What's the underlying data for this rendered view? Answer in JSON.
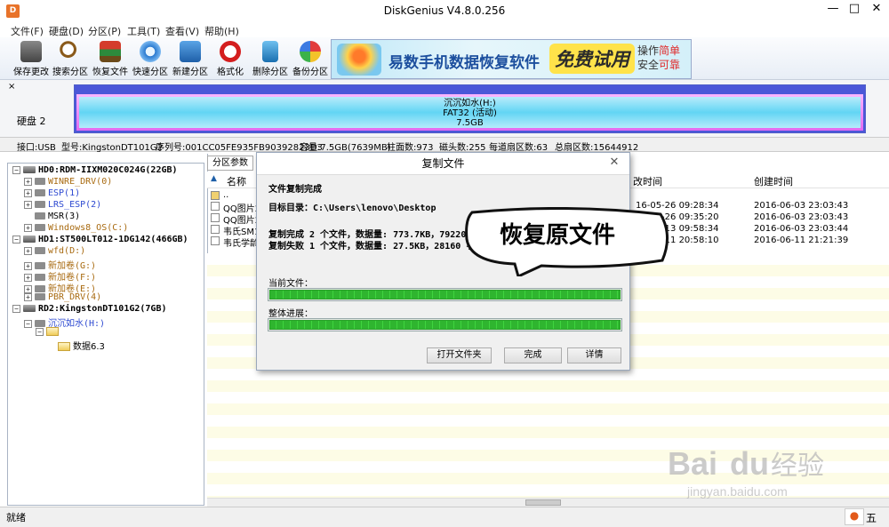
{
  "window": {
    "title": "DiskGenius V4.8.0.256",
    "icon_letter": "D",
    "min": "—",
    "max": "□",
    "close": "✕"
  },
  "menu": [
    "文件(F)",
    "硬盘(D)",
    "分区(P)",
    "工具(T)",
    "查看(V)",
    "帮助(H)"
  ],
  "toolbar": [
    "保存更改",
    "搜索分区",
    "恢复文件",
    "快速分区",
    "新建分区",
    "格式化",
    "删除分区",
    "备份分区"
  ],
  "ad": {
    "text": "易数手机数据恢复软件",
    "badge": "免费试用",
    "line1": "操作",
    "line1b": "简单",
    "line2": "安全",
    "line2b": "可靠"
  },
  "disk": {
    "label": "硬盘 2",
    "partition_name": "沉沉如水(H:)",
    "partition_fs": "FAT32 (活动)",
    "partition_size": "7.5GB",
    "collapse": "×"
  },
  "info": {
    "interface": "接口:USB",
    "model": "型号:KingstonDT101G2",
    "serial": "序列号:001CC05FE935FB90392823D3",
    "capacity": "容量:7.5GB(7639MB)",
    "cylinders": "柱面数:973",
    "heads": "磁头数:255",
    "sectors_per_track": "每道扇区数:63",
    "total_sectors": "总扇区数:15644912"
  },
  "tree": [
    {
      "label": "HD0:RDM-IIXM020C024G(22GB)",
      "level": 0,
      "kind": "disk",
      "toggle": "−"
    },
    {
      "label": "WINRE_DRV(0)",
      "level": 1,
      "kind": "part",
      "color": "brown",
      "toggle": "+"
    },
    {
      "label": "ESP(1)",
      "level": 1,
      "kind": "part",
      "color": "blue",
      "toggle": "+"
    },
    {
      "label": "LRS_ESP(2)",
      "level": 1,
      "kind": "part",
      "color": "blue",
      "toggle": "+"
    },
    {
      "label": "MSR(3)",
      "level": 1,
      "kind": "part",
      "color": "",
      "toggle": ""
    },
    {
      "label": "Windows8_OS(C:)",
      "level": 1,
      "kind": "part",
      "color": "brown",
      "toggle": "+"
    },
    {
      "label": "HD1:ST500LT012-1DG142(466GB)",
      "level": 0,
      "kind": "disk",
      "toggle": "−"
    },
    {
      "label": "wfd(D:)",
      "level": 1,
      "kind": "part",
      "color": "brown",
      "toggle": "+"
    },
    {
      "label": "新加卷(G:)",
      "level": 1,
      "kind": "part",
      "color": "brown",
      "toggle": "+"
    },
    {
      "label": "新加卷(F:)",
      "level": 1,
      "kind": "part",
      "color": "brown",
      "toggle": "+"
    },
    {
      "label": "新加卷(E:)",
      "level": 1,
      "kind": "part",
      "color": "brown",
      "toggle": "+"
    },
    {
      "label": "PBR_DRV(4)",
      "level": 1,
      "kind": "part",
      "color": "brown",
      "toggle": "+"
    },
    {
      "label": "RD2:KingstonDT101G2(7GB)",
      "level": 0,
      "kind": "disk",
      "toggle": "−"
    },
    {
      "label": "沉沉如水(H:)",
      "level": 1,
      "kind": "part",
      "color": "blue",
      "toggle": "−"
    },
    {
      "label": "",
      "level": 2,
      "kind": "folder",
      "color": "",
      "toggle": "−"
    },
    {
      "label": "数据6.3",
      "level": 3,
      "kind": "folder",
      "color": "",
      "toggle": ""
    }
  ],
  "right": {
    "tab": "分区参数",
    "col_name": "名称",
    "col_modified": "改时间",
    "col_created": "创建时间",
    "rows": [
      {
        "name": "..",
        "modified": "",
        "created": ""
      },
      {
        "name": "QQ图片20",
        "modified": "16-05-26 09:28:34",
        "created": "2016-06-03 23:03:43"
      },
      {
        "name": "QQ图片20",
        "modified": "16-05-26 09:35:20",
        "created": "2016-06-03 23:03:43"
      },
      {
        "name": "韦氏SM1.",
        "modified": "16-06-13 09:58:34",
        "created": "2016-06-03 23:03:44"
      },
      {
        "name": "韦氏学龄",
        "modified": "16-06-11 20:58:10",
        "created": "2016-06-11 21:21:39"
      }
    ]
  },
  "dialog": {
    "title": "复制文件",
    "close": "✕",
    "status": "文件复制完成",
    "target": "目标目录：C:\\Users\\lenovo\\Desktop",
    "ok_line": "复制完成 2 个文件，数据量: 773.7KB，792202 字节。",
    "fail_line": "复制失败 1 个文件，数据量: 27.5KB，28160 字节。",
    "current_label": "当前文件：",
    "overall_label": "整体进展：",
    "current_progress": 1.0,
    "overall_progress": 1.0,
    "btn_open": "打开文件夹",
    "btn_done": "完成",
    "btn_detail": "详情"
  },
  "annotation": {
    "text": "恢复原文件"
  },
  "status": {
    "text": "就绪",
    "ime": "五"
  },
  "watermark": {
    "brand": "Bai",
    "brand2": "du",
    "cn": "经验",
    "url": "jingyan.baidu.com"
  }
}
